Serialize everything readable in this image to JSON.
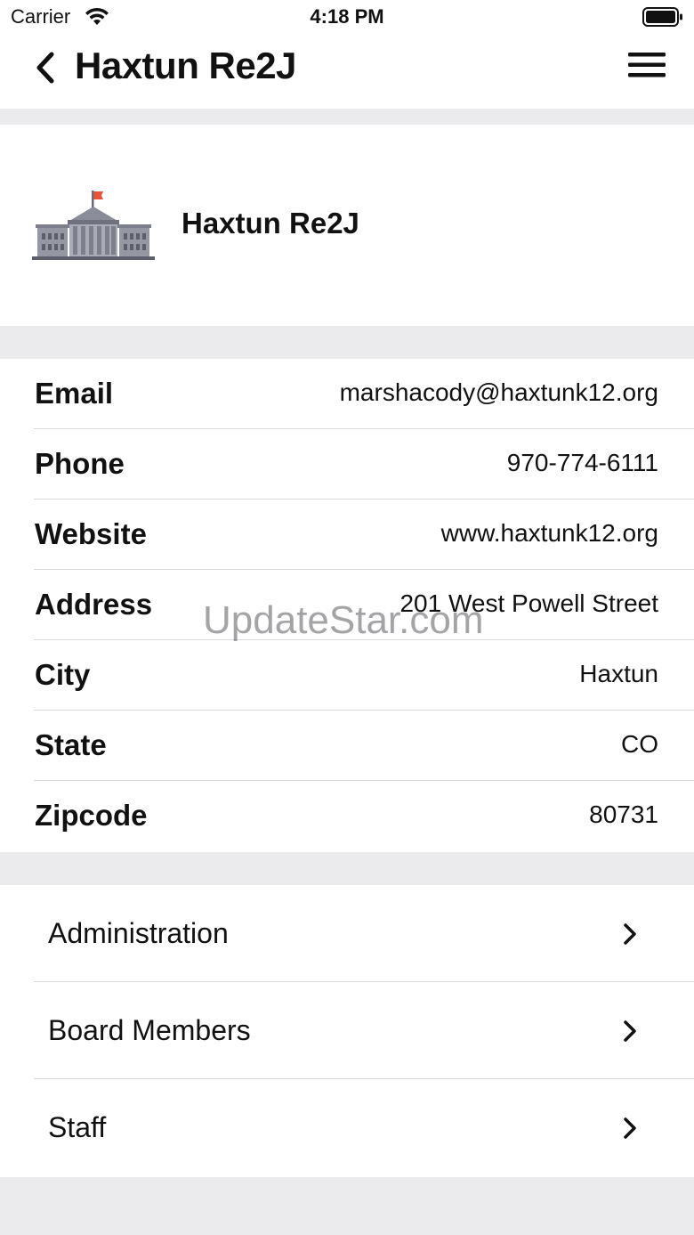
{
  "status_bar": {
    "carrier": "Carrier",
    "time": "4:18 PM"
  },
  "nav": {
    "title": "Haxtun Re2J",
    "back_icon": "chevron-left-icon",
    "menu_icon": "hamburger-menu-icon"
  },
  "header": {
    "icon": "school-building-icon",
    "name": "Haxtun Re2J"
  },
  "info": [
    {
      "label": "Email",
      "value": "marshacody@haxtunk12.org"
    },
    {
      "label": "Phone",
      "value": "970-774-6111"
    },
    {
      "label": "Website",
      "value": "www.haxtunk12.org"
    },
    {
      "label": "Address",
      "value": "201 West Powell Street"
    },
    {
      "label": "City",
      "value": "Haxtun"
    },
    {
      "label": "State",
      "value": "CO"
    },
    {
      "label": "Zipcode",
      "value": "80731"
    }
  ],
  "links": [
    {
      "label": "Administration"
    },
    {
      "label": "Board Members"
    },
    {
      "label": "Staff"
    }
  ],
  "watermark": "UpdateStar.com",
  "colors": {
    "background": "#ebebed",
    "card": "#ffffff",
    "divider": "#d8d8dc",
    "flag": "#e8533a",
    "building": "#7d7f8d"
  }
}
